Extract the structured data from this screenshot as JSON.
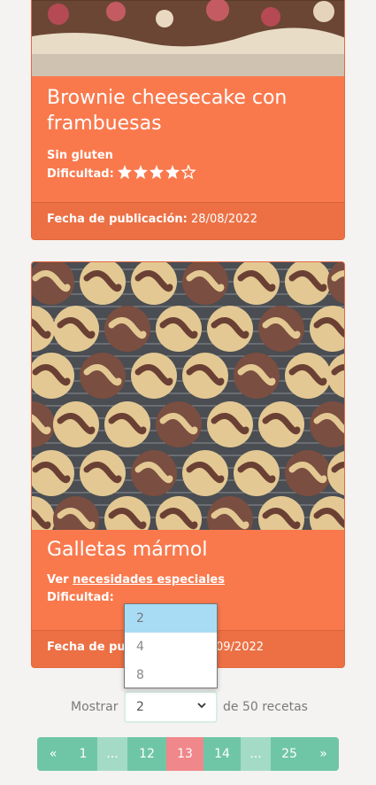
{
  "recipes": [
    {
      "title": "Brownie cheesecake con frambuesas",
      "special_label": "Sin gluten",
      "difficulty_label": "Dificultad:",
      "difficulty": 4,
      "difficulty_max": 5,
      "date_label": "Fecha de publicación:",
      "date": "28/08/2022"
    },
    {
      "title": "Galletas mármol",
      "special_prefix": "Ver",
      "special_link": "necesidades especiales",
      "difficulty_label": "Dificultad:",
      "date_label": "Fecha de pu",
      "date_suffix": "09/2022"
    }
  ],
  "pagination": {
    "show_label": "Mostrar",
    "per_page": "2",
    "total_label": "de 50 recetas",
    "options": [
      "2",
      "4",
      "8"
    ],
    "pages": [
      "«",
      "1",
      "...",
      "12",
      "13",
      "14",
      "...",
      "25",
      "»"
    ],
    "current": "13"
  },
  "colors": {
    "card": "#f9794d",
    "footer": "#ec7044",
    "pager": "#6fc6a6",
    "pager_active": "#f0878a",
    "option_selected": "#a8dcf5"
  }
}
